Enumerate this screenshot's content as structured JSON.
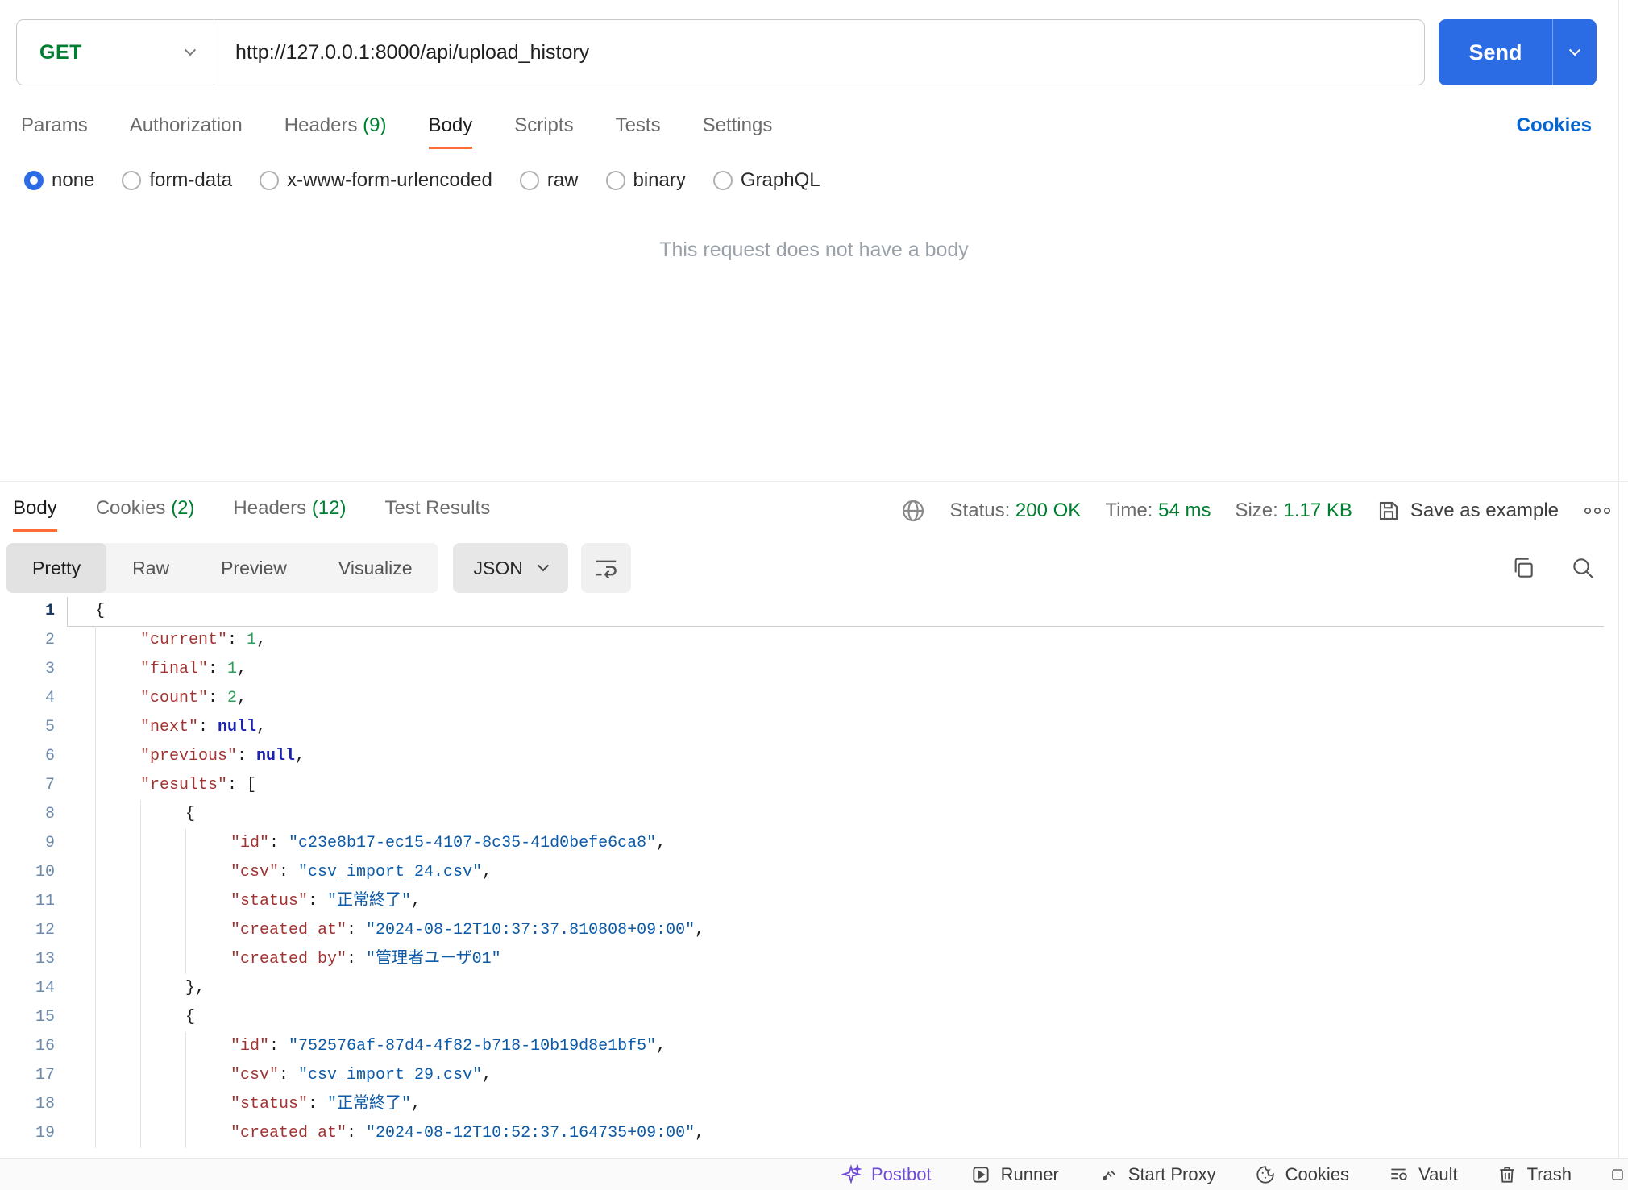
{
  "colors": {
    "accent_orange": "#ff6c37",
    "primary_blue": "#2b6ce4",
    "link_blue": "#0265d2",
    "success_green": "#007f31",
    "postbot_purple": "#6e4bd8"
  },
  "request": {
    "method": "GET",
    "url": "http://127.0.0.1:8000/api/upload_history",
    "send_label": "Send",
    "cookies_link": "Cookies",
    "tabs": [
      {
        "label": "Params"
      },
      {
        "label": "Authorization"
      },
      {
        "label": "Headers ",
        "count": "(9)"
      },
      {
        "label": "Body",
        "active": true
      },
      {
        "label": "Scripts"
      },
      {
        "label": "Tests"
      },
      {
        "label": "Settings"
      }
    ],
    "body_types": {
      "selected": "none",
      "options": [
        "none",
        "form-data",
        "x-www-form-urlencoded",
        "raw",
        "binary",
        "GraphQL"
      ]
    },
    "empty_message": "This request does not have a body"
  },
  "response": {
    "tabs": [
      {
        "label": "Body",
        "active": true
      },
      {
        "label": "Cookies ",
        "count": "(2)"
      },
      {
        "label": "Headers ",
        "count": "(12)"
      },
      {
        "label": "Test Results"
      }
    ],
    "meta": [
      {
        "label": "Status: ",
        "value": "200 OK"
      },
      {
        "label": "Time: ",
        "value": "54 ms"
      },
      {
        "label": "Size: ",
        "value": "1.17 KB"
      }
    ],
    "save_as_example": "Save as example",
    "view_tabs": [
      {
        "label": "Pretty",
        "active": true
      },
      {
        "label": "Raw"
      },
      {
        "label": "Preview"
      },
      {
        "label": "Visualize"
      }
    ],
    "language": "JSON",
    "code": {
      "lines": [
        {
          "n": 1,
          "d": 0,
          "active": true,
          "t": [
            [
              "p",
              "{"
            ]
          ]
        },
        {
          "n": 2,
          "d": 1,
          "t": [
            [
              "k",
              "\"current\""
            ],
            [
              "p",
              ": "
            ],
            [
              "n",
              "1"
            ],
            [
              "p",
              ","
            ]
          ]
        },
        {
          "n": 3,
          "d": 1,
          "t": [
            [
              "k",
              "\"final\""
            ],
            [
              "p",
              ": "
            ],
            [
              "n",
              "1"
            ],
            [
              "p",
              ","
            ]
          ]
        },
        {
          "n": 4,
          "d": 1,
          "t": [
            [
              "k",
              "\"count\""
            ],
            [
              "p",
              ": "
            ],
            [
              "n",
              "2"
            ],
            [
              "p",
              ","
            ]
          ]
        },
        {
          "n": 5,
          "d": 1,
          "t": [
            [
              "k",
              "\"next\""
            ],
            [
              "p",
              ": "
            ],
            [
              "u",
              "null"
            ],
            [
              "p",
              ","
            ]
          ]
        },
        {
          "n": 6,
          "d": 1,
          "t": [
            [
              "k",
              "\"previous\""
            ],
            [
              "p",
              ": "
            ],
            [
              "u",
              "null"
            ],
            [
              "p",
              ","
            ]
          ]
        },
        {
          "n": 7,
          "d": 1,
          "t": [
            [
              "k",
              "\"results\""
            ],
            [
              "p",
              ": ["
            ]
          ]
        },
        {
          "n": 8,
          "d": 2,
          "t": [
            [
              "p",
              "{"
            ]
          ]
        },
        {
          "n": 9,
          "d": 3,
          "t": [
            [
              "k",
              "\"id\""
            ],
            [
              "p",
              ": "
            ],
            [
              "s",
              "\"c23e8b17-ec15-4107-8c35-41d0befe6ca8\""
            ],
            [
              "p",
              ","
            ]
          ]
        },
        {
          "n": 10,
          "d": 3,
          "t": [
            [
              "k",
              "\"csv\""
            ],
            [
              "p",
              ": "
            ],
            [
              "s",
              "\"csv_import_24.csv\""
            ],
            [
              "p",
              ","
            ]
          ]
        },
        {
          "n": 11,
          "d": 3,
          "t": [
            [
              "k",
              "\"status\""
            ],
            [
              "p",
              ": "
            ],
            [
              "s",
              "\"正常終了\""
            ],
            [
              "p",
              ","
            ]
          ]
        },
        {
          "n": 12,
          "d": 3,
          "t": [
            [
              "k",
              "\"created_at\""
            ],
            [
              "p",
              ": "
            ],
            [
              "s",
              "\"2024-08-12T10:37:37.810808+09:00\""
            ],
            [
              "p",
              ","
            ]
          ]
        },
        {
          "n": 13,
          "d": 3,
          "t": [
            [
              "k",
              "\"created_by\""
            ],
            [
              "p",
              ": "
            ],
            [
              "s",
              "\"管理者ユーザ01\""
            ]
          ]
        },
        {
          "n": 14,
          "d": 2,
          "t": [
            [
              "p",
              "},"
            ]
          ]
        },
        {
          "n": 15,
          "d": 2,
          "t": [
            [
              "p",
              "{"
            ]
          ]
        },
        {
          "n": 16,
          "d": 3,
          "t": [
            [
              "k",
              "\"id\""
            ],
            [
              "p",
              ": "
            ],
            [
              "s",
              "\"752576af-87d4-4f82-b718-10b19d8e1bf5\""
            ],
            [
              "p",
              ","
            ]
          ]
        },
        {
          "n": 17,
          "d": 3,
          "t": [
            [
              "k",
              "\"csv\""
            ],
            [
              "p",
              ": "
            ],
            [
              "s",
              "\"csv_import_29.csv\""
            ],
            [
              "p",
              ","
            ]
          ]
        },
        {
          "n": 18,
          "d": 3,
          "t": [
            [
              "k",
              "\"status\""
            ],
            [
              "p",
              ": "
            ],
            [
              "s",
              "\"正常終了\""
            ],
            [
              "p",
              ","
            ]
          ]
        },
        {
          "n": 19,
          "d": 3,
          "t": [
            [
              "k",
              "\"created_at\""
            ],
            [
              "p",
              ": "
            ],
            [
              "s",
              "\"2024-08-12T10:52:37.164735+09:00\""
            ],
            [
              "p",
              ","
            ]
          ]
        }
      ]
    }
  },
  "footer": {
    "items": [
      {
        "label": "Postbot"
      },
      {
        "label": "Runner"
      },
      {
        "label": "Start Proxy"
      },
      {
        "label": "Cookies"
      },
      {
        "label": "Vault"
      },
      {
        "label": "Trash"
      }
    ]
  }
}
